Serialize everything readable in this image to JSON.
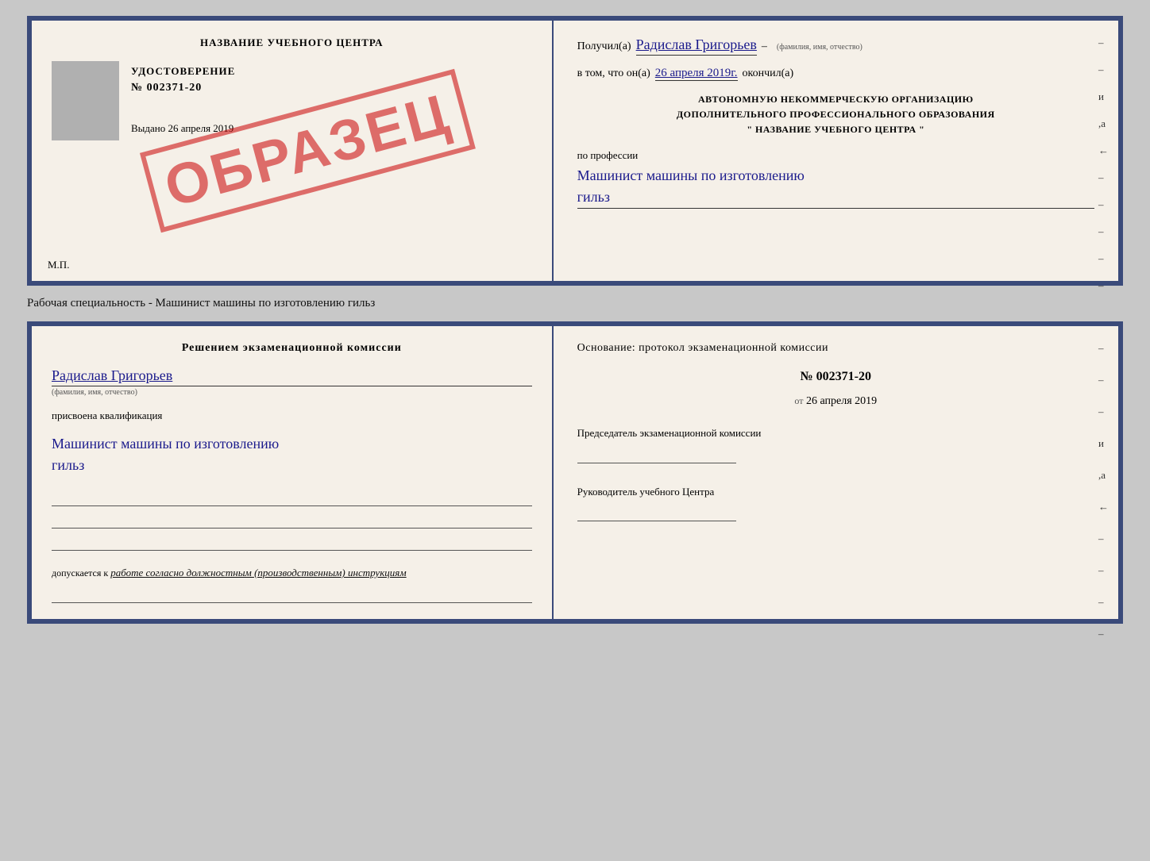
{
  "top_doc": {
    "left": {
      "training_center": "НАЗВАНИЕ УЧЕБНОГО ЦЕНТРА",
      "grey_box": true,
      "cert_title": "УДОСТОВЕРЕНИЕ",
      "cert_number": "№ 002371-20",
      "issued_label": "Выдано",
      "issued_date": "26 апреля 2019",
      "mp": "М.П.",
      "stamp": "ОБРАЗЕЦ"
    },
    "right": {
      "received_prefix": "Получил(а)",
      "recipient_name": "Радислав Григорьев",
      "fio_caption": "(фамилия, имя, отчество)",
      "dash1": "–",
      "vtom_prefix": "в том, что он(а)",
      "vtom_date": "26 апреля 2019г.",
      "okonchil": "окончил(а)",
      "dash2": "–",
      "org_line1": "АВТОНОМНУЮ НЕКОММЕРЧЕСКУЮ ОРГАНИЗАЦИЮ",
      "org_line2": "ДОПОЛНИТЕЛЬНОГО ПРОФЕССИОНАЛЬНОГО ОБРАЗОВАНИЯ",
      "org_line3": "\"    НАЗВАНИЕ УЧЕБНОГО ЦЕНТРА    \"",
      "dash3": "–",
      "i_letter": "и",
      "a_letter": ",а",
      "left_arrow": "←",
      "profession_label": "по профессии",
      "profession_handwritten": "Машинист машины по изготовлению",
      "profession_line2": "гильз"
    }
  },
  "specialty_label": "Рабочая специальность - Машинист машины по изготовлению гильз",
  "bottom_doc": {
    "left": {
      "decision_title": "Решением  экзаменационной  комиссии",
      "person_name": "Радислав Григорьев",
      "fio_caption": "(фамилия, имя, отчество)",
      "qualification_label": "присвоена квалификация",
      "qualification_handwritten": "Машинист машины по изготовлению",
      "qualification_line2": "гильз",
      "dopuskaetsya_prefix": "допускается к",
      "dopuskaetsya_text": "работе согласно должностным (производственным) инструкциям"
    },
    "right": {
      "osnovanye": "Основание: протокол экзаменационной  комиссии",
      "protocol_number": "№  002371-20",
      "ot_prefix": "от",
      "protocol_date": "26 апреля 2019",
      "chairman_title": "Председатель экзаменационной комиссии",
      "rukavod_title": "Руководитель учебного Центра",
      "dash1": "–",
      "dash2": "–",
      "i_letter": "и",
      "a_letter": ",а",
      "left_arrow": "←",
      "dashes_right": [
        "–",
        "–",
        "–",
        "–"
      ]
    }
  }
}
